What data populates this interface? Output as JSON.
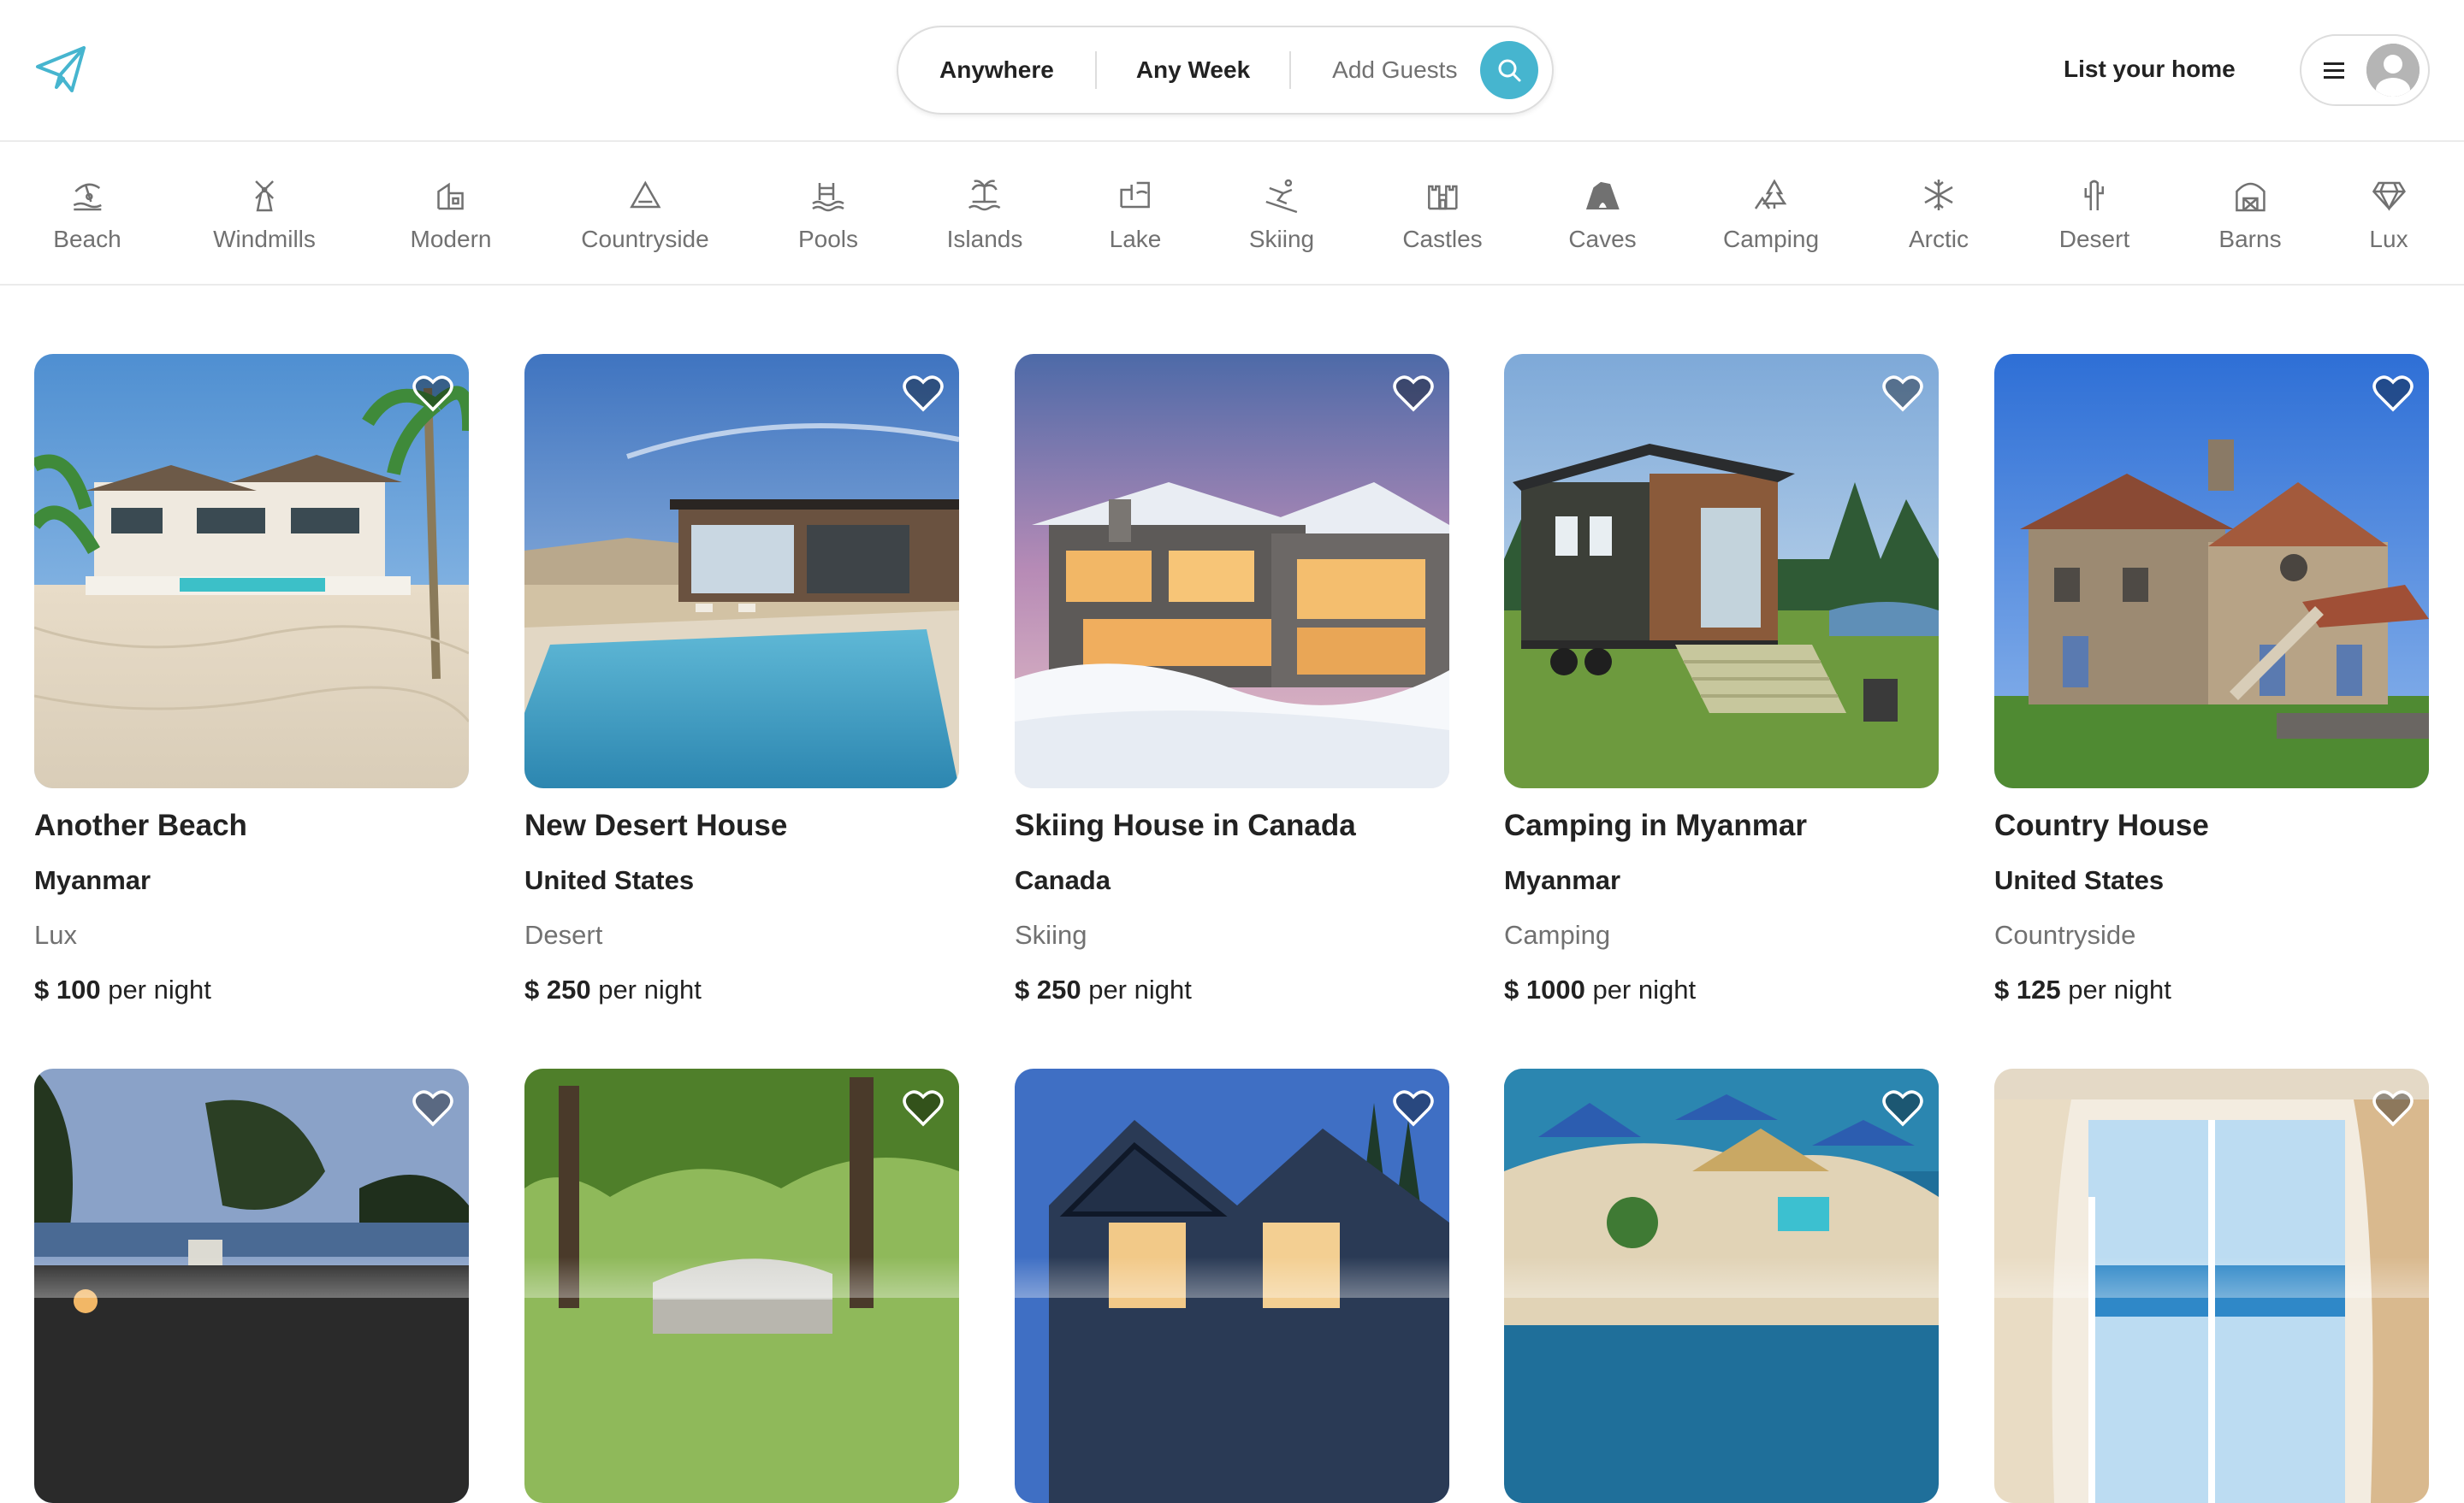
{
  "header": {
    "search": {
      "location": "Anywhere",
      "week": "Any Week",
      "guests": "Add Guests"
    },
    "list_home": "List your home",
    "accent_color": "#46b5cf"
  },
  "categories": [
    {
      "label": "Beach",
      "icon": "beach-icon"
    },
    {
      "label": "Windmills",
      "icon": "windmill-icon"
    },
    {
      "label": "Modern",
      "icon": "modern-house-icon"
    },
    {
      "label": "Countryside",
      "icon": "mountain-icon"
    },
    {
      "label": "Pools",
      "icon": "pool-icon"
    },
    {
      "label": "Islands",
      "icon": "island-icon"
    },
    {
      "label": "Lake",
      "icon": "lake-icon"
    },
    {
      "label": "Skiing",
      "icon": "skiing-icon"
    },
    {
      "label": "Castles",
      "icon": "castle-icon"
    },
    {
      "label": "Caves",
      "icon": "cave-icon"
    },
    {
      "label": "Camping",
      "icon": "camping-icon"
    },
    {
      "label": "Arctic",
      "icon": "snowflake-icon"
    },
    {
      "label": "Desert",
      "icon": "cactus-icon"
    },
    {
      "label": "Barns",
      "icon": "barn-icon"
    },
    {
      "label": "Lux",
      "icon": "diamond-icon"
    }
  ],
  "listings": [
    {
      "title": "Another Beach",
      "location": "Myanmar",
      "category": "Lux",
      "price": "$ 100",
      "per": "per night"
    },
    {
      "title": "New Desert House",
      "location": "United States",
      "category": "Desert",
      "price": "$ 250",
      "per": "per night"
    },
    {
      "title": "Skiing House in Canada",
      "location": "Canada",
      "category": "Skiing",
      "price": "$ 250",
      "per": "per night"
    },
    {
      "title": "Camping in Myanmar",
      "location": "Myanmar",
      "category": "Camping",
      "price": "$ 1000",
      "per": "per night"
    },
    {
      "title": "Country House",
      "location": "United States",
      "category": "Countryside",
      "price": "$ 125",
      "per": "per night"
    }
  ]
}
